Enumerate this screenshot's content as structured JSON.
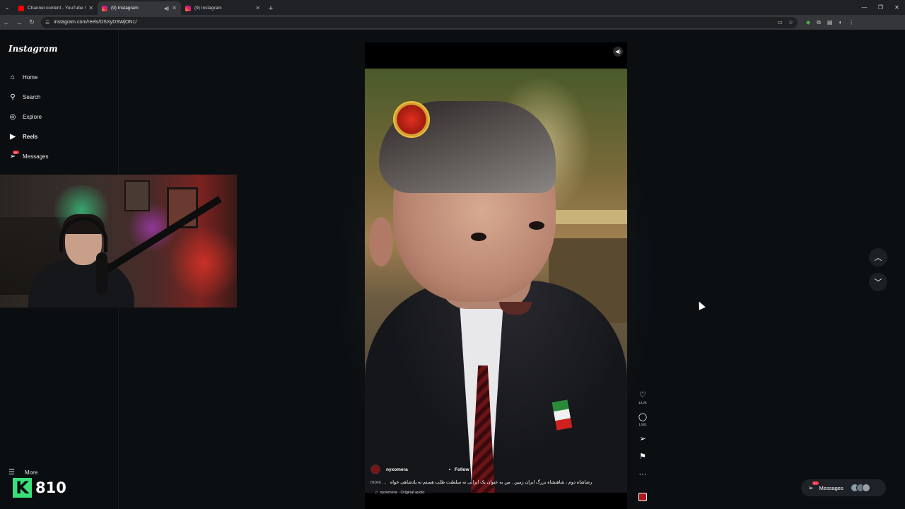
{
  "browser": {
    "tabs": [
      {
        "title": "Channel content - YouTube Stu",
        "type": "yt",
        "active": false
      },
      {
        "title": "(9) Instagram",
        "type": "ig",
        "active": true
      },
      {
        "title": "(9) Instagram",
        "type": "ig",
        "active": false
      }
    ],
    "url": "instagram.com/reels/DSXyDSWjON1/"
  },
  "sidebar": {
    "logo": "Instagram",
    "items": [
      {
        "label": "Home",
        "icon": "home-icon"
      },
      {
        "label": "Search",
        "icon": "search-icon"
      },
      {
        "label": "Explore",
        "icon": "compass-icon"
      },
      {
        "label": "Reels",
        "icon": "reels-icon"
      },
      {
        "label": "Messages",
        "icon": "send-icon",
        "badge": "9+"
      }
    ],
    "more_label": "More"
  },
  "reel": {
    "username": "nyxomera",
    "follow_label": "Follow",
    "more_label": "more ...",
    "caption": "رضاشاه دوم ، شاهنشاه بزرگ ایران زمین . من به عنوان یک ایرانی نه سلطنت طلب هستم نه پادشاهی خواه",
    "audio": "nyxomera · Original audio",
    "likes": "13.2K",
    "comments": "1,501"
  },
  "messages_pill": {
    "label": "Messages",
    "badge": "9+"
  },
  "stream_overlay": {
    "k_letter": "K",
    "count": "810"
  },
  "colors": {
    "accent": "#39e07a",
    "badge": "#ff3040",
    "bg": "#0b0f12"
  }
}
